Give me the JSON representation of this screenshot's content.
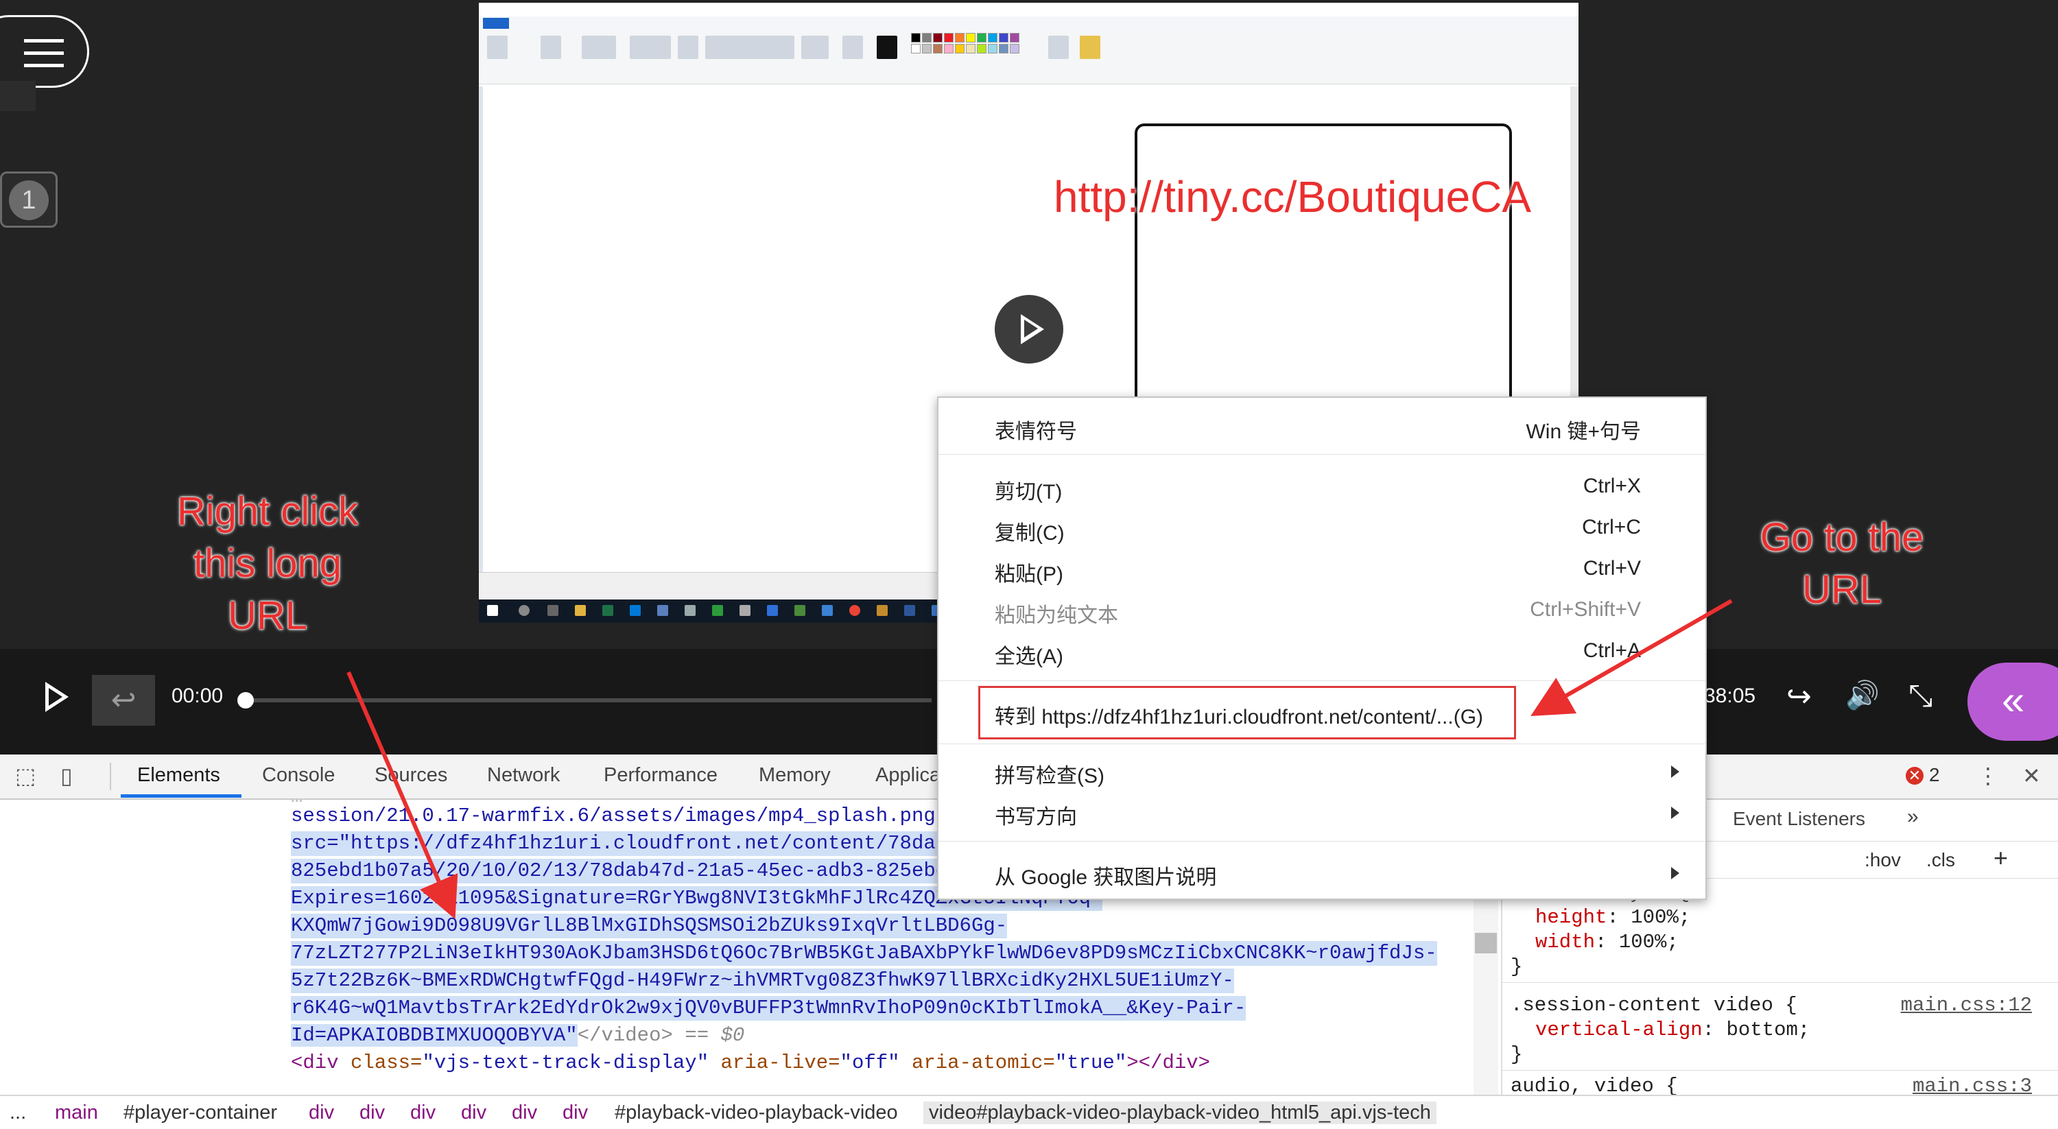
{
  "video": {
    "overlay_url": "http://tiny.cc/BoutiqueCA",
    "badge_number": "1",
    "annotation_left": [
      "Right click",
      "this long",
      "URL"
    ],
    "annotation_right": [
      "Go to the",
      "URL"
    ]
  },
  "controls": {
    "current_time": "00:00",
    "duration": "38:05",
    "progress_fraction": 0.0
  },
  "devtools": {
    "tabs": [
      "Elements",
      "Console",
      "Sources",
      "Network",
      "Performance",
      "Memory",
      "Applica"
    ],
    "active_tab": "Elements",
    "error_count": "2",
    "dom_lines": [
      "session/21.0.17-warmfix.6/assets/images/mp4_splash.png\"  p",
      "src=\"https://dfz4hf1hz1uri.cloudfront.net/content/78dab47",
      "825ebd1b07a5/20/10/02/13/78dab47d-21a5-45ec-adb3-825ebd1b",
      "Expires=1602211095&Signature=RGrYBwg8NVI3tGkMhFJlRc4ZQZxGtUIlNqPY6q-",
      "KXQmW7jGowi9D098U9VGrlL8BlMxGIDhSQSMSOi2bZUks9IxqVrltLBD6Gg-",
      "77zLZT277P2LiN3eIkHT930AoKJbam3HSD6tQ6Oc7BrWB5KGtJaBAXbPYkFlwWD6ev8PD9sMCzIiCbxCNC8KK~r0awjfdJs-",
      "5z7t22Bz6K~BMExRDWCHgtwfFQgd-H49FWrz~ihVMRTvg08Z3fhwK97llBRXcidKy2HXL5UE1iUmzY-",
      "r6K4G~wQ1MavtbsTrArk2EdYdrOk2w9xjQV0vBUFFP3tWmnRvIhoP09n0cKIbTlImokA__&Key-Pair-",
      "Id=APKAIOBDBIMXUOQOBYVA\""
    ],
    "dom_close": "</video>",
    "dom_eq": "== $0",
    "dom_div_tag": "<div ",
    "dom_div_class_attr": "class=",
    "dom_div_class_val": "\"vjs-text-track-display\"",
    "dom_div_live_attr": " aria-live=",
    "dom_div_live_val": "\"off\"",
    "dom_div_atomic_attr": " aria-atomic=",
    "dom_div_atomic_val": "\"true\"",
    "dom_div_close": "></div>",
    "styles": {
      "event_listeners": "Event Listeners",
      "hov": ":hov",
      "cls": ".cls",
      "element_style": "element.style {",
      "height_prop": "height",
      "height_val": "100%;",
      "width_prop": "width",
      "width_val": "100%;",
      "close_brace": "}",
      "session_rule": ".session-content video {",
      "session_link": "main.css:12",
      "valign_prop": "vertical-align",
      "valign_val": "bottom;",
      "audio_rule": "audio, video {",
      "audio_link": "main.css:3"
    },
    "breadcrumbs": [
      "...",
      "main",
      "#player-container",
      "div",
      "div",
      "div",
      "div",
      "div",
      "div",
      "#playback-video-playback-video",
      "video#playback-video-playback-video_html5_api.vjs-tech"
    ]
  },
  "context_menu": {
    "items": [
      {
        "label": "表情符号",
        "shortcut": "Win 键+句号"
      },
      {
        "label": "剪切(T)",
        "shortcut": "Ctrl+X"
      },
      {
        "label": "复制(C)",
        "shortcut": "Ctrl+C"
      },
      {
        "label": "粘贴(P)",
        "shortcut": "Ctrl+V"
      },
      {
        "label": "粘贴为纯文本",
        "shortcut": "Ctrl+Shift+V"
      },
      {
        "label": "全选(A)",
        "shortcut": "Ctrl+A"
      },
      {
        "label": "转到 https://dfz4hf1hz1uri.cloudfront.net/content/...(G)"
      },
      {
        "label": "拼写检查(S)"
      },
      {
        "label": "书写方向"
      },
      {
        "label": "从 Google 获取图片说明"
      }
    ]
  },
  "colors": {
    "annotation_red": "#ea2f2f",
    "accent_purple": "#b85ad4",
    "devtools_blue": "#1a73e8"
  }
}
